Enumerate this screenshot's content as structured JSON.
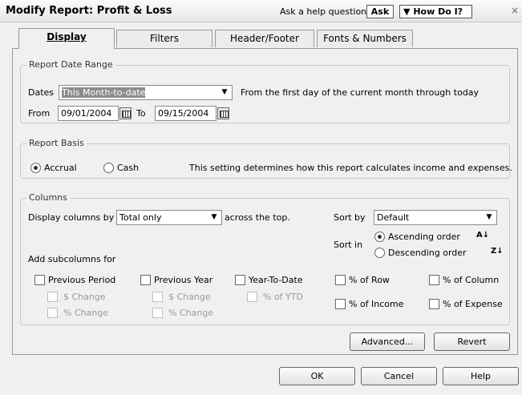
{
  "window": {
    "title": "Modify Report: Profit & Loss",
    "help_prompt": "Ask a help question",
    "ask_label": "Ask",
    "howdo_label": "How Do I?",
    "close_glyph": "×"
  },
  "tabs": [
    {
      "label": "Display",
      "active": true
    },
    {
      "label": "Filters",
      "active": false
    },
    {
      "label": "Header/Footer",
      "active": false
    },
    {
      "label": "Fonts & Numbers",
      "active": false
    }
  ],
  "date_range": {
    "legend": "Report Date Range",
    "dates_label": "Dates",
    "dates_value": "This Month-to-date",
    "description": "From the first day of the current month through today",
    "from_label": "From",
    "from_value": "09/01/2004",
    "to_label": "To",
    "to_value": "09/15/2004"
  },
  "basis": {
    "legend": "Report Basis",
    "accrual_label": "Accrual",
    "cash_label": "Cash",
    "selected": "Accrual",
    "description": "This setting determines how this report calculates income and expenses."
  },
  "columns": {
    "legend": "Columns",
    "display_label": "Display columns by",
    "display_value": "Total only",
    "across_label": "across the top.",
    "sort_by_label": "Sort by",
    "sort_by_value": "Default",
    "sort_in_label": "Sort in",
    "ascending_label": "Ascending order",
    "descending_label": "Descending order",
    "sort_selected": "Ascending order",
    "subcolumns_label": "Add subcolumns for",
    "previous_period": "Previous Period",
    "previous_year": "Previous Year",
    "year_to_date": "Year-To-Date",
    "pp_dollar": "$ Change",
    "pp_percent": "% Change",
    "py_dollar": "$ Change",
    "py_percent": "% Change",
    "ytd_percent": "% of YTD",
    "pct_row": "% of Row",
    "pct_column": "% of Column",
    "pct_income": "% of Income",
    "pct_expense": "% of Expense"
  },
  "buttons": {
    "advanced": "Advanced...",
    "revert": "Revert",
    "ok": "OK",
    "cancel": "Cancel",
    "help": "Help"
  }
}
